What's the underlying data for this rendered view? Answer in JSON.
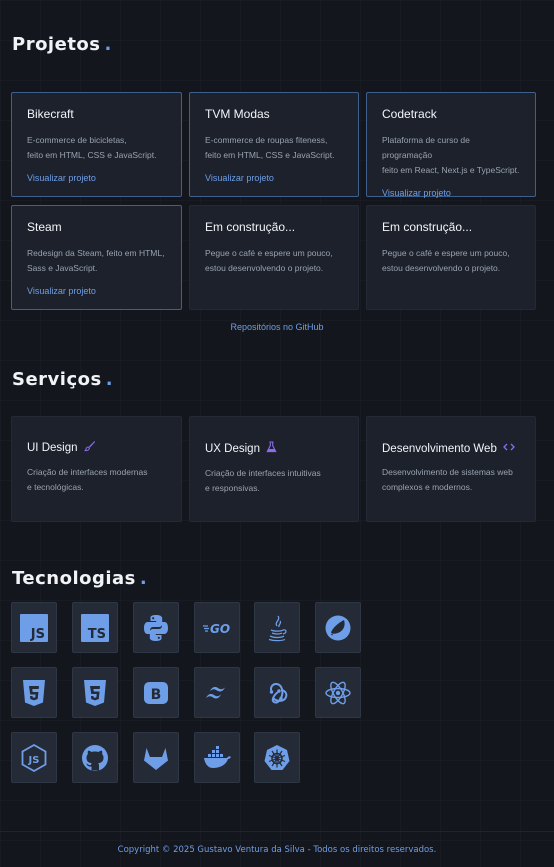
{
  "projects": {
    "title": "Projetos",
    "dot": ".",
    "items": [
      {
        "name": "Bikecraft",
        "description": "E-commerce de bicicletas,\nfeito em HTML, CSS e JavaScript.",
        "link": "Visualizar projeto"
      },
      {
        "name": "TVM Modas",
        "description": "E-commerce de roupas fiteness,\nfeito em HTML, CSS e JavaScript.",
        "link": "Visualizar projeto"
      },
      {
        "name": "Codetrack",
        "description": "Plataforma de curso de programação\nfeito em React, Next.js e TypeScript.",
        "link": "Visualizar projeto"
      },
      {
        "name": "Steam",
        "description": "Redesign da Steam, feito em HTML,\nSass e JavaScript.",
        "link": "Visualizar projeto"
      },
      {
        "name": "Em construção...",
        "description": "Pegue o café e espere um pouco,\nestou desenvolvendo o projeto."
      },
      {
        "name": "Em construção...",
        "description": "Pegue o café e espere um pouco,\nestou desenvolvendo o projeto."
      }
    ],
    "github_link": "Repositórios no GitHub"
  },
  "services": {
    "title": "Serviços",
    "dot": ".",
    "items": [
      {
        "name": "UI Design",
        "icon": "brush-icon",
        "description": "Criação de interfaces modernas\ne tecnológicas."
      },
      {
        "name": "UX Design",
        "icon": "flask-icon",
        "description": "Criação de interfaces intuitivas\ne responsivas."
      },
      {
        "name": "Desenvolvimento Web",
        "icon": "code-icon",
        "description": "Desenvolvimento de sistemas web\ncomplexos e modernos."
      }
    ]
  },
  "technologies": {
    "title": "Tecnologias",
    "dot": ".",
    "items": [
      "javascript-icon",
      "typescript-icon",
      "python-icon",
      "go-icon",
      "java-icon",
      "spring-icon",
      "html5-icon",
      "css3-icon",
      "bootstrap-icon",
      "tailwind-icon",
      "redux-icon",
      "react-icon",
      "nodejs-icon",
      "github-icon",
      "gitlab-icon",
      "docker-icon",
      "kubernetes-icon"
    ]
  },
  "footer": {
    "text": "Copyright © 2025 Gustavo Ventura da Silva - Todos os direitos reservados."
  },
  "colors": {
    "accent": "#6f9ee8",
    "background": "#13161d",
    "card": "#1c212b",
    "icon": "#6f9ee8",
    "ui_icon": "#8b6cf0"
  }
}
